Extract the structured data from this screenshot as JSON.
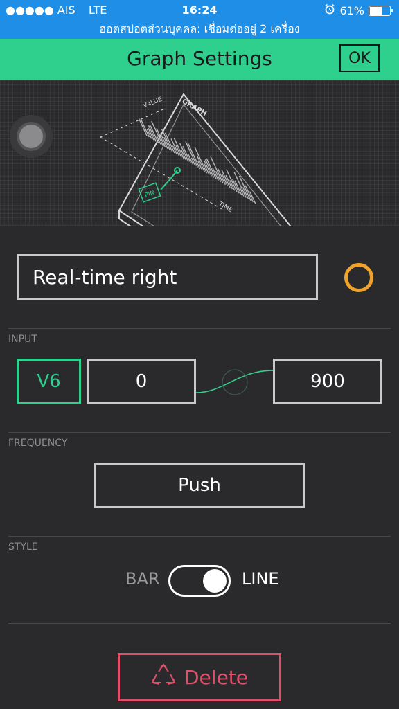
{
  "status_bar": {
    "carrier": "●●●●● AIS",
    "network": "LTE",
    "time": "16:24",
    "battery": "61%",
    "battery_level": 0.61,
    "hotspot": "ฮอตสปอตส่วนบุคคล: เชื่อมต่ออยู่ 2 เครื่อง"
  },
  "header": {
    "title": "Graph Settings",
    "ok_label": "OK"
  },
  "preview": {
    "value_label": "VALUE",
    "graph_label": "GRAPH",
    "pin_label": "PIN",
    "time_label": "TIME"
  },
  "title_field": {
    "value": "Real-time right"
  },
  "colors": {
    "accent": "#2fd08d",
    "color_picker": "#f0a32a",
    "delete": "#e0506b",
    "status_bar": "#1e8ee6"
  },
  "input": {
    "label": "INPUT",
    "pin": "V6",
    "min": "0",
    "max": "900"
  },
  "frequency": {
    "label": "FREQUENCY",
    "value": "Push"
  },
  "style": {
    "label": "STYLE",
    "left_option": "BAR",
    "right_option": "LINE",
    "selected": "LINE"
  },
  "delete": {
    "label": "Delete"
  }
}
